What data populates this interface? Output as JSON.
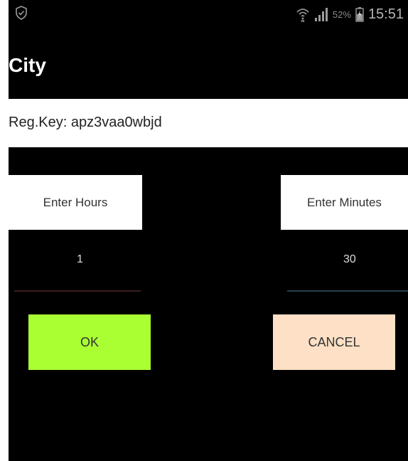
{
  "status_bar": {
    "left_icon": "shield-check-icon",
    "wifi_icon": "wifi-icon",
    "signal_icon": "signal-icon",
    "battery_percent": "52%",
    "battery_icon": "battery-charging-icon",
    "time": "15:51"
  },
  "app_bar": {
    "title": "City"
  },
  "registration": {
    "text": "Reg.Key: apz3vaa0wbjd"
  },
  "hours": {
    "label": "Enter Hours",
    "value": "1"
  },
  "minutes": {
    "label": "Enter Minutes",
    "value": "30"
  },
  "buttons": {
    "ok": "OK",
    "cancel": "CANCEL"
  },
  "colors": {
    "ok_bg": "#aaff33",
    "cancel_bg": "#fde0c5",
    "background": "#000000"
  }
}
